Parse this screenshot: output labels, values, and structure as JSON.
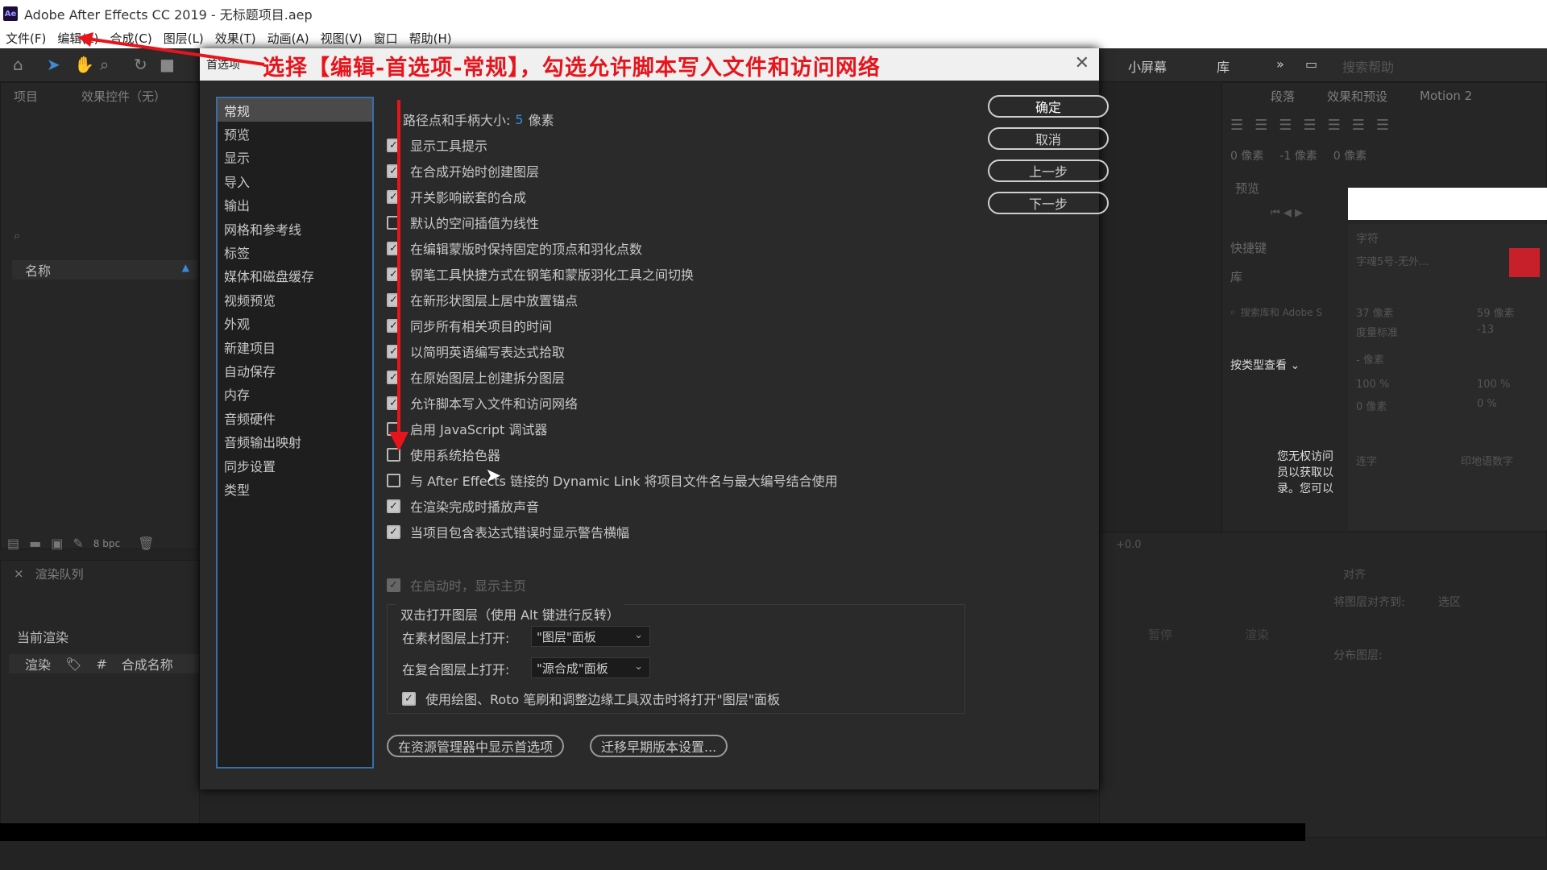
{
  "window": {
    "title": "Adobe After Effects CC 2019 - 无标题项目.aep",
    "app_icon": "Ae"
  },
  "menu": [
    "文件(F)",
    "编辑(E)",
    "合成(C)",
    "图层(L)",
    "效果(T)",
    "动画(A)",
    "视图(V)",
    "窗口",
    "帮助(H)"
  ],
  "workspace": {
    "small_screen": "小屏幕",
    "library": "库",
    "more": "»",
    "search_placeholder": "搜索帮助"
  },
  "annotation": "选择【编辑-首选项-常规】，勾选允许脚本写入文件和访问网络",
  "left_panel": {
    "tab_project": "项目",
    "tab_effects": "效果控件（无）",
    "name_header": "名称",
    "bpc": "8 bpc",
    "render_queue": "渲染队列",
    "current_render": "当前渲染",
    "col_render": "渲染",
    "col_num": "#",
    "col_comp_name": "合成名称"
  },
  "right_panel": {
    "paragraph": "段落",
    "effects_presets": "效果和预设",
    "motion2": "Motion 2",
    "indent_left": "0 像素",
    "indent_first": "-1 像素",
    "indent_right": "0 像素",
    "preview": "预览",
    "shortcut": "快捷键",
    "libraries": "库",
    "lib_search": "搜索库和 Adobe S",
    "view_by_type": "按类型查看",
    "no_access": "您无权访问员以获取以录。您可以",
    "character": "字符",
    "font": "字魂5号-无外...",
    "size": "37 像素",
    "leading": "59 像素",
    "tracking_label": "度量标准",
    "kerning": "-13",
    "stroke": "- 像素",
    "v_scale": "100 %",
    "h_scale": "100 %",
    "baseline": "0 像素",
    "tsume": "0 %",
    "ligature": "连字",
    "hindi": "印地语数字",
    "align": "对齐",
    "align_to": "将图层对齐到:",
    "selection": "选区",
    "distribute": "分布图层:",
    "pause": "暂停",
    "render": "渲染",
    "offset": "+0.0",
    "brand_color": "#c8202b"
  },
  "dialog": {
    "title": "首选项",
    "categories": [
      "常规",
      "预览",
      "显示",
      "导入",
      "输出",
      "网格和参考线",
      "标签",
      "媒体和磁盘缓存",
      "视频预览",
      "外观",
      "新建项目",
      "自动保存",
      "内存",
      "音频硬件",
      "音频输出映射",
      "同步设置",
      "类型"
    ],
    "selected_category": "常规",
    "buttons": {
      "ok": "确定",
      "cancel": "取消",
      "prev": "上一步",
      "next": "下一步"
    },
    "path_size_label": "路径点和手柄大小:",
    "path_size_value": "5",
    "path_size_unit": "像素",
    "options": [
      {
        "label": "显示工具提示",
        "checked": true
      },
      {
        "label": "在合成开始时创建图层",
        "checked": true
      },
      {
        "label": "开关影响嵌套的合成",
        "checked": true
      },
      {
        "label": "默认的空间插值为线性",
        "checked": false
      },
      {
        "label": "在编辑蒙版时保持固定的顶点和羽化点数",
        "checked": true
      },
      {
        "label": "钢笔工具快捷方式在钢笔和蒙版羽化工具之间切换",
        "checked": true
      },
      {
        "label": "在新形状图层上居中放置锚点",
        "checked": true
      },
      {
        "label": "同步所有相关项目的时间",
        "checked": true
      },
      {
        "label": "以简明英语编写表达式拾取",
        "checked": true
      },
      {
        "label": "在原始图层上创建拆分图层",
        "checked": true
      },
      {
        "label": "允许脚本写入文件和访问网络",
        "checked": true
      },
      {
        "label": "启用 JavaScript 调试器",
        "checked": false
      },
      {
        "label": "使用系统拾色器",
        "checked": false
      },
      {
        "label": "与 After Effects 链接的 Dynamic Link 将项目文件名与最大编号结合使用",
        "checked": false
      },
      {
        "label": "在渲染完成时播放声音",
        "checked": true
      },
      {
        "label": "当项目包含表达式错误时显示警告横幅",
        "checked": true
      }
    ],
    "startup_home": "在启动时，显示主页",
    "double_click_title": "双击打开图层（使用 Alt 键进行反转）",
    "footage_label": "在素材图层上打开:",
    "footage_value": "\"图层\"面板",
    "comp_label": "在复合图层上打开:",
    "comp_value": "\"源合成\"面板",
    "paint_option": "使用绘图、Roto 笔刷和调整边缘工具双击时将打开\"图层\"面板",
    "reveal_btn": "在资源管理器中显示首选项",
    "migrate_btn": "迁移早期版本设置..."
  }
}
